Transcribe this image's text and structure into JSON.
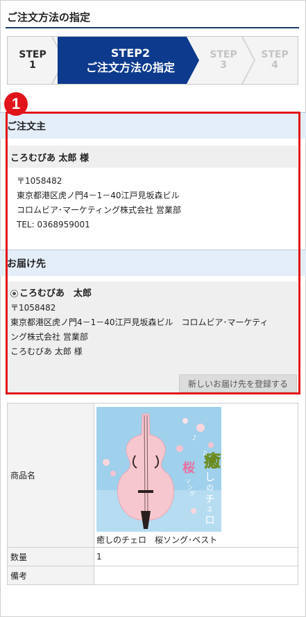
{
  "page": {
    "title": "ご注文方法の指定"
  },
  "stepper": {
    "step1": {
      "label": "STEP",
      "number": "1"
    },
    "step2": {
      "label": "STEP2",
      "name": "ご注文方法の指定"
    },
    "step3": {
      "label": "STEP",
      "number": "3"
    },
    "step4": {
      "label": "STEP",
      "number": "4"
    }
  },
  "badge": {
    "number": "1"
  },
  "orderer": {
    "heading": "ご注文主",
    "name": "ころむびあ 太郎 様",
    "postal": "〒1058482",
    "address": "東京都港区虎ノ門4－1－40江戸見坂森ビル",
    "company": "コロムビア･マーケティング株式会社 営業部",
    "tel": "TEL: 0368959001"
  },
  "delivery": {
    "heading": "お届け先",
    "selected_name": "ころむびあ　太郎",
    "postal": "〒1058482",
    "address_line1": "東京都港区虎ノ門4－1－40江戸見坂森ビル　コロムビア･マーケティ",
    "address_line2": "ング株式会社 営業部",
    "recipient": "ころむびあ 太郎 様",
    "register_button": "新しいお届け先を登録する"
  },
  "product_table": {
    "product_label": "商品名",
    "product_name": "癒しのチェロ　桜ソング･ベスト",
    "cover_title_chars": [
      "癒",
      "し",
      "の",
      "チ",
      "ェ",
      "ロ"
    ],
    "cover_sub1": "桜",
    "cover_sub2": "ソング･ベスト",
    "quantity_label": "数量",
    "quantity_value": "1",
    "note_label": "備考",
    "note_value": ""
  },
  "colors": {
    "accent_navy": "#0d3a8c",
    "highlight_red": "#e1141b",
    "section_bg": "#e4eef9"
  }
}
